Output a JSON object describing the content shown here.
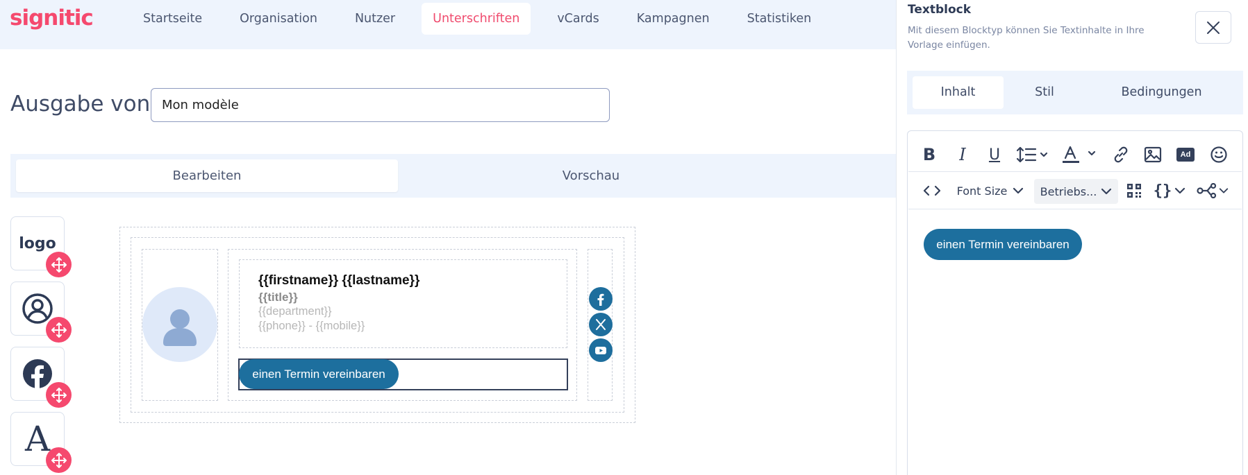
{
  "brand": {
    "name": "signitic",
    "accent": "#f5496e",
    "blue": "#1d6f9e"
  },
  "nav": {
    "items": [
      "Startseite",
      "Organisation",
      "Nutzer",
      "Unterschriften",
      "vCards",
      "Kampagnen",
      "Statistiken"
    ],
    "active": "Unterschriften"
  },
  "edition": {
    "label": "Ausgabe von",
    "value": "Mon modèle"
  },
  "mode": {
    "tabs": [
      "Bearbeiten",
      "Vorschau"
    ],
    "active": "Bearbeiten"
  },
  "blocks": [
    {
      "name": "logo",
      "label": "logo"
    },
    {
      "name": "avatar",
      "icon": "user-circle-icon"
    },
    {
      "name": "social",
      "icon": "facebook-icon"
    },
    {
      "name": "text",
      "label": "A"
    }
  ],
  "signature": {
    "name": "{{firstname}} {{lastname}}",
    "title": "{{title}}",
    "department": "{{department}}",
    "phone": "{{phone}} - {{mobile}}",
    "cta": "einen Termin vereinbaren",
    "social": [
      "facebook-icon",
      "x-icon",
      "youtube-icon"
    ]
  },
  "panel": {
    "title": "Textblock",
    "description": "Mit diesem Blocktyp können Sie Textinhalte in Ihre Vorlage einfügen.",
    "tabs": [
      "Inhalt",
      "Stil",
      "Bedingungen"
    ],
    "active_tab": "Inhalt",
    "toolbar": {
      "font_size": "Font Size",
      "font_family": "Betriebs...",
      "ad_label": "Ad"
    },
    "content_button": "einen Termin vereinbaren"
  }
}
